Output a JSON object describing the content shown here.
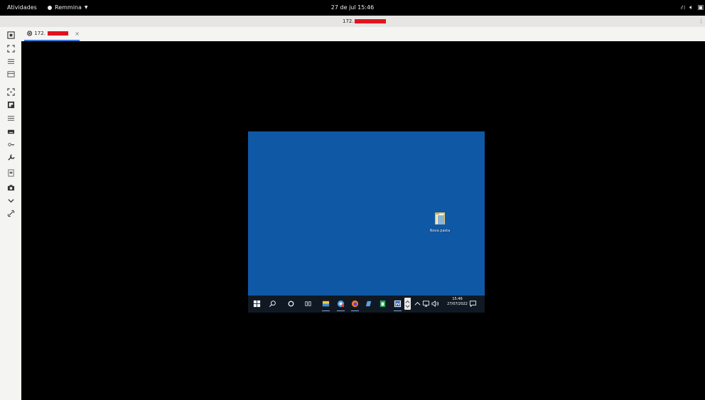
{
  "topbar": {
    "activities": "Atividades",
    "app_name": "Remmina",
    "clock": "27 de jul  15:46"
  },
  "header": {
    "connection_title": "172."
  },
  "tab": {
    "label": "172.",
    "close": "×"
  },
  "toolbar": {
    "items": [
      "fullscreen-icon",
      "fit-window-icon",
      "menu-icon",
      "dynamic-resolution-icon",
      "scaled-mode-icon",
      "resize-icon",
      "preferences-icon",
      "keyboard-icon",
      "keys-icon",
      "tools-icon",
      "multimonitor-icon",
      "screenshot-icon",
      "minimize-icon",
      "disconnect-icon"
    ]
  },
  "remote_desktop": {
    "background": "#0f58a6",
    "folder_label": "Nova pasta",
    "taskbar": {
      "time": "15:46",
      "date": "27/07/2022"
    }
  },
  "colors": {
    "accent": "#3a7bd5",
    "redaction": "#e0141e"
  }
}
